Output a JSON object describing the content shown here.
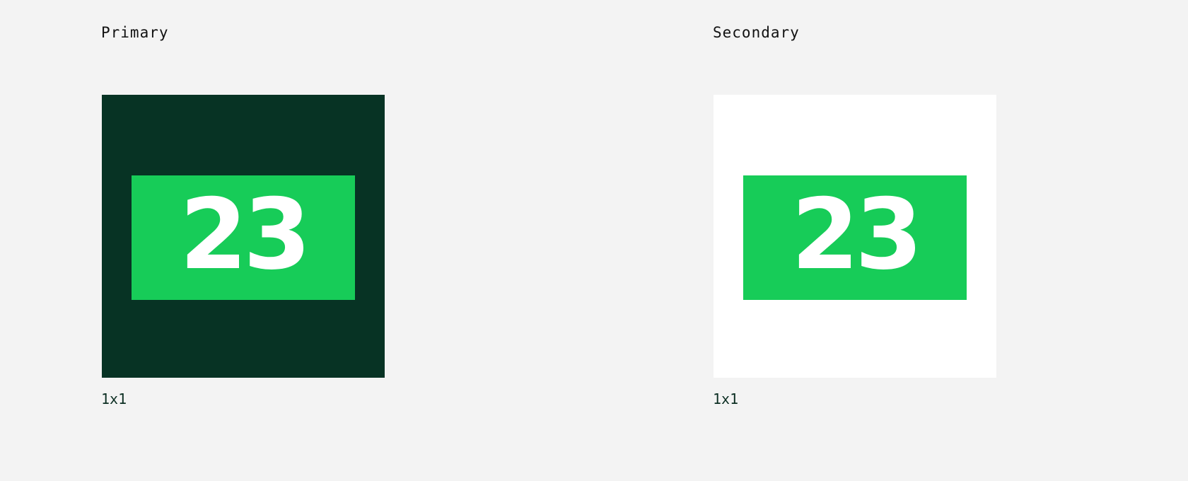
{
  "variants": [
    {
      "title": "Primary",
      "badge_number": "23",
      "size_label": "1x1",
      "tile_color": "#073324"
    },
    {
      "title": "Secondary",
      "badge_number": "23",
      "size_label": "1x1",
      "tile_color": "#ffffff"
    }
  ],
  "colors": {
    "page_background": "#f3f3f3",
    "badge_green": "#17cc58",
    "badge_text": "#ffffff"
  }
}
